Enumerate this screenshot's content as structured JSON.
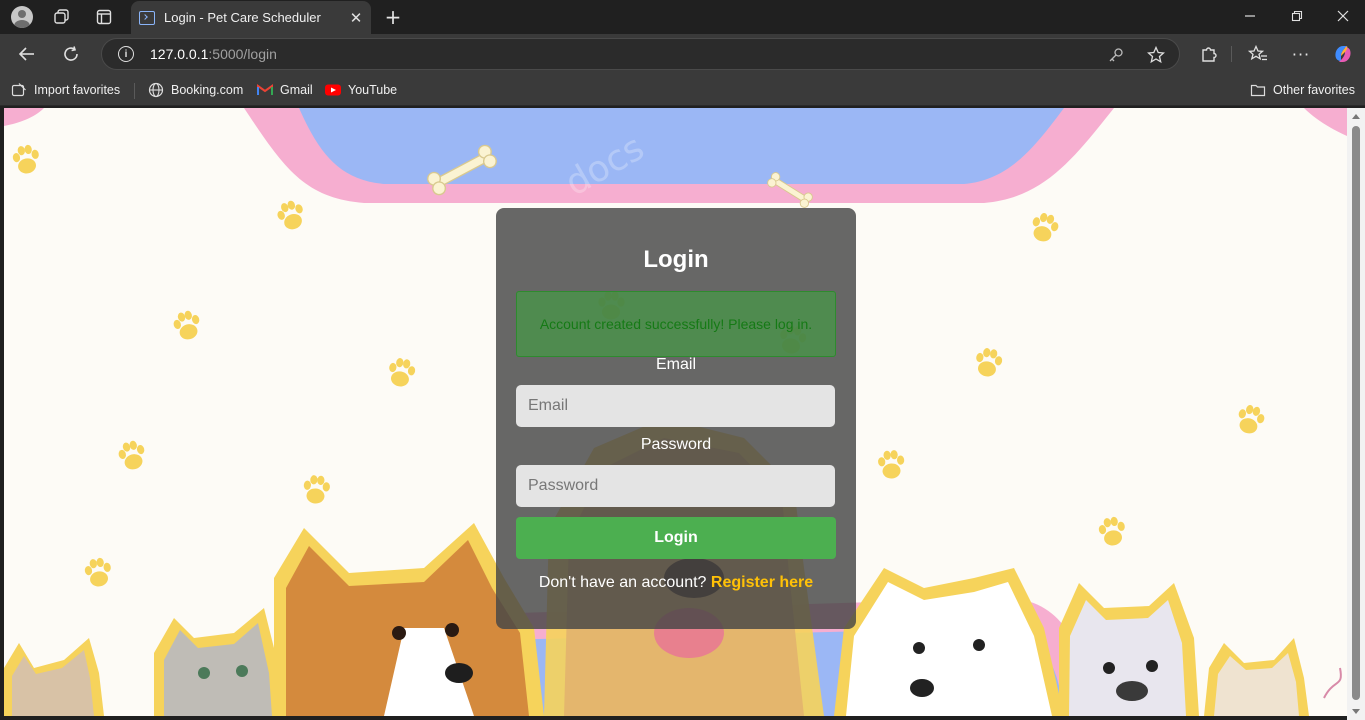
{
  "browser": {
    "tab_title": "Login - Pet Care Scheduler",
    "url_host": "127.0.0.1",
    "url_path": ":5000/login",
    "bookmarks": [
      {
        "label": "Import favorites",
        "icon": "import-icon"
      },
      {
        "label": "Booking.com",
        "icon": "globe-icon"
      },
      {
        "label": "Gmail",
        "icon": "gmail-icon"
      },
      {
        "label": "YouTube",
        "icon": "youtube-icon"
      }
    ],
    "other_favorites": "Other favorites"
  },
  "login": {
    "title": "Login",
    "flash_message": "Account created successfully! Please log in.",
    "email_label": "Email",
    "email_placeholder": "Email",
    "password_label": "Password",
    "password_placeholder": "Password",
    "submit_label": "Login",
    "register_prompt": "Don't have an account?",
    "register_link": "Register here"
  },
  "colors": {
    "submit_button": "#4caf50",
    "register_link": "#ffc107",
    "flash_text": "#157a15"
  }
}
